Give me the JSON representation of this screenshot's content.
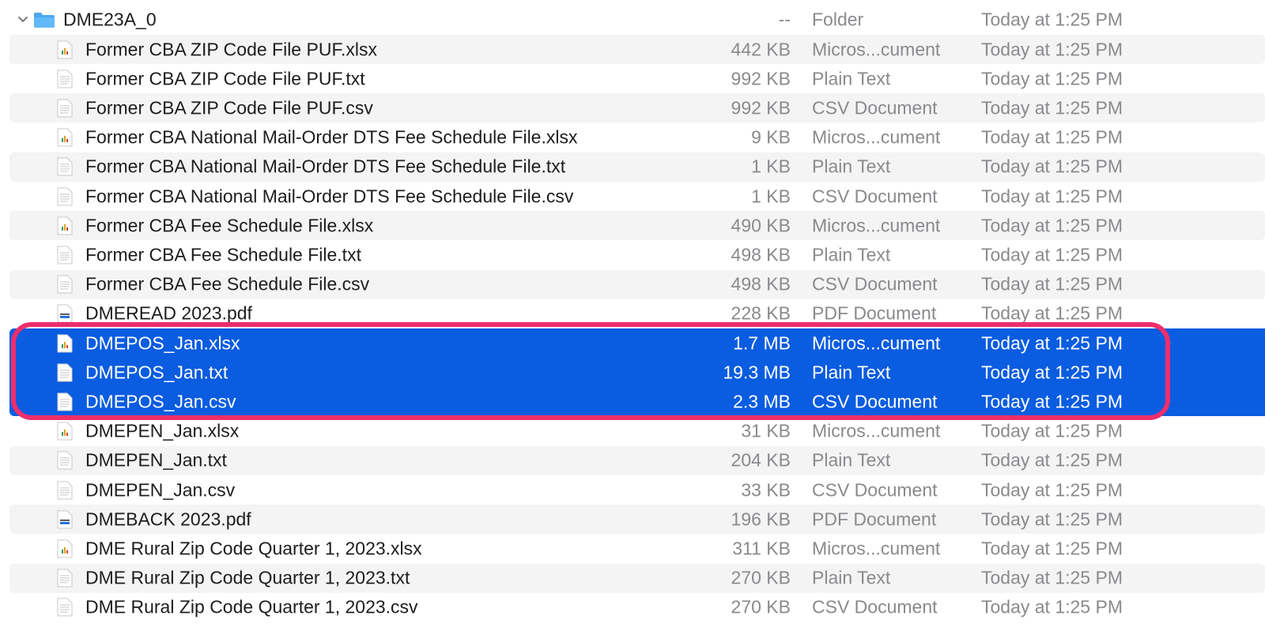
{
  "folder": {
    "name": "DME23A_0",
    "size": "--",
    "kind": "Folder",
    "date": "Today at 1:25 PM"
  },
  "files": [
    {
      "name": "Former CBA ZIP Code File PUF.xlsx",
      "size": "442 KB",
      "kind": "Micros...cument",
      "date": "Today at 1:25 PM",
      "icon": "excel-file-icon"
    },
    {
      "name": "Former CBA ZIP Code File PUF.txt",
      "size": "992 KB",
      "kind": "Plain Text",
      "date": "Today at 1:25 PM",
      "icon": "text-file-icon"
    },
    {
      "name": "Former CBA ZIP Code File PUF.csv",
      "size": "992 KB",
      "kind": "CSV Document",
      "date": "Today at 1:25 PM",
      "icon": "text-file-icon"
    },
    {
      "name": "Former CBA National Mail-Order DTS Fee Schedule File.xlsx",
      "size": "9 KB",
      "kind": "Micros...cument",
      "date": "Today at 1:25 PM",
      "icon": "excel-file-icon"
    },
    {
      "name": "Former CBA National Mail-Order DTS Fee Schedule File.txt",
      "size": "1 KB",
      "kind": "Plain Text",
      "date": "Today at 1:25 PM",
      "icon": "text-file-icon"
    },
    {
      "name": "Former CBA National Mail-Order DTS Fee Schedule File.csv",
      "size": "1 KB",
      "kind": "CSV Document",
      "date": "Today at 1:25 PM",
      "icon": "text-file-icon"
    },
    {
      "name": "Former CBA Fee Schedule File.xlsx",
      "size": "490 KB",
      "kind": "Micros...cument",
      "date": "Today at 1:25 PM",
      "icon": "excel-file-icon"
    },
    {
      "name": "Former CBA Fee Schedule File.txt",
      "size": "498 KB",
      "kind": "Plain Text",
      "date": "Today at 1:25 PM",
      "icon": "text-file-icon"
    },
    {
      "name": "Former CBA Fee Schedule File.csv",
      "size": "498 KB",
      "kind": "CSV Document",
      "date": "Today at 1:25 PM",
      "icon": "text-file-icon"
    },
    {
      "name": "DMEREAD 2023.pdf",
      "size": "228 KB",
      "kind": "PDF Document",
      "date": "Today at 1:25 PM",
      "icon": "pdf-file-icon"
    },
    {
      "name": "DMEPOS_Jan.xlsx",
      "size": "1.7 MB",
      "kind": "Micros...cument",
      "date": "Today at 1:25 PM",
      "icon": "excel-file-icon",
      "selected": true
    },
    {
      "name": "DMEPOS_Jan.txt",
      "size": "19.3 MB",
      "kind": "Plain Text",
      "date": "Today at 1:25 PM",
      "icon": "text-file-icon",
      "selected": true
    },
    {
      "name": "DMEPOS_Jan.csv",
      "size": "2.3 MB",
      "kind": "CSV Document",
      "date": "Today at 1:25 PM",
      "icon": "text-file-icon",
      "selected": true
    },
    {
      "name": "DMEPEN_Jan.xlsx",
      "size": "31 KB",
      "kind": "Micros...cument",
      "date": "Today at 1:25 PM",
      "icon": "excel-file-icon"
    },
    {
      "name": "DMEPEN_Jan.txt",
      "size": "204 KB",
      "kind": "Plain Text",
      "date": "Today at 1:25 PM",
      "icon": "text-file-icon"
    },
    {
      "name": "DMEPEN_Jan.csv",
      "size": "33 KB",
      "kind": "CSV Document",
      "date": "Today at 1:25 PM",
      "icon": "text-file-icon"
    },
    {
      "name": "DMEBACK 2023.pdf",
      "size": "196 KB",
      "kind": "PDF Document",
      "date": "Today at 1:25 PM",
      "icon": "pdf-file-icon"
    },
    {
      "name": "DME Rural Zip Code Quarter 1, 2023.xlsx",
      "size": "311 KB",
      "kind": "Micros...cument",
      "date": "Today at 1:25 PM",
      "icon": "excel-file-icon"
    },
    {
      "name": "DME Rural Zip Code Quarter 1, 2023.txt",
      "size": "270 KB",
      "kind": "Plain Text",
      "date": "Today at 1:25 PM",
      "icon": "text-file-icon"
    },
    {
      "name": "DME Rural Zip Code Quarter 1, 2023.csv",
      "size": "270 KB",
      "kind": "CSV Document",
      "date": "Today at 1:25 PM",
      "icon": "text-file-icon"
    }
  ],
  "colors": {
    "selection": "#0a5ce0",
    "highlight_outline": "#ee2e6c",
    "folder": "#4aa8f0"
  }
}
